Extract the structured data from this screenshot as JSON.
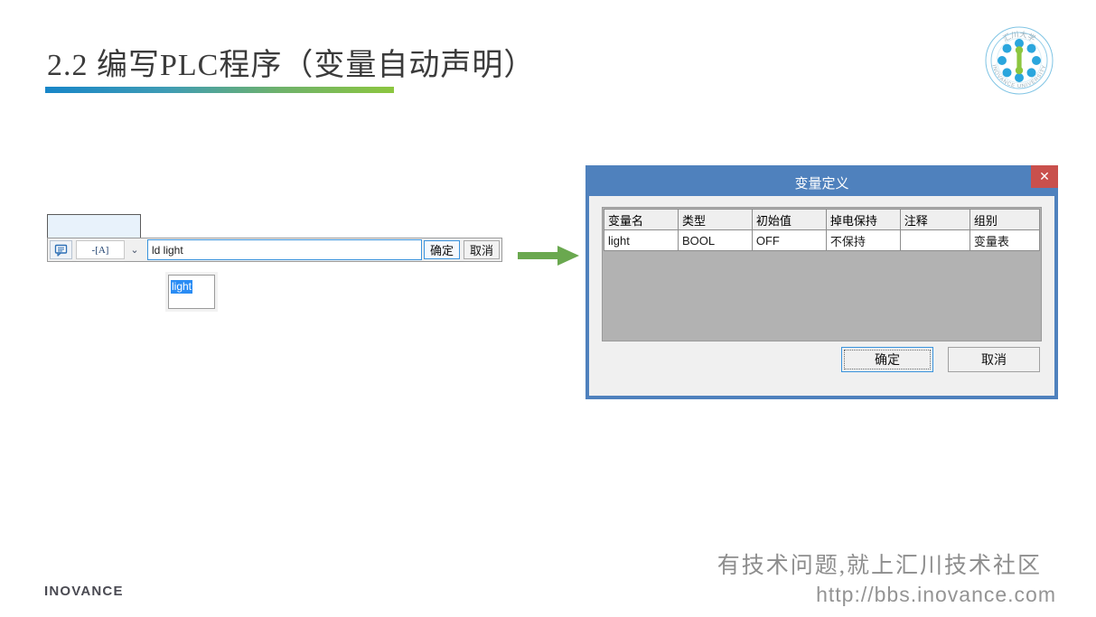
{
  "slide": {
    "title": "2.2 编写PLC程序（变量自动声明）",
    "brand": "INOVANCE",
    "footer_slogan": "有技术问题,就上汇川技术社区",
    "footer_url": "http://bbs.inovance.com",
    "accent_start": "#1886c8",
    "accent_end": "#8cc63f"
  },
  "emblem": {
    "top_text": "汇川大学",
    "bottom_text": "INOVANCE UNIVERSITY",
    "dot_color": "#2ba6dd",
    "center_color": "#8cc63f"
  },
  "ladder": {
    "comment_icon": "comment-icon",
    "contact_label": "-[A]",
    "chevron": "⌄",
    "expression_value": "ld light",
    "expression_placeholder": "",
    "confirm_label": "确定",
    "cancel_label": "取消",
    "autocomplete_item": "light"
  },
  "arrow": {
    "color": "#6aa84f",
    "direction": "right"
  },
  "dialog": {
    "title": "变量定义",
    "close_glyph": "✕",
    "columns": [
      "变量名",
      "类型",
      "初始值",
      "掉电保持",
      "注释",
      "组别"
    ],
    "rows": [
      {
        "name": "light",
        "type": "BOOL",
        "initial": "OFF",
        "retain": "不保持",
        "comment": "",
        "group": "变量表"
      }
    ],
    "ok_label": "确定",
    "cancel_label": "取消",
    "titlebar_color": "#4f81bd",
    "close_color": "#c9504c"
  }
}
